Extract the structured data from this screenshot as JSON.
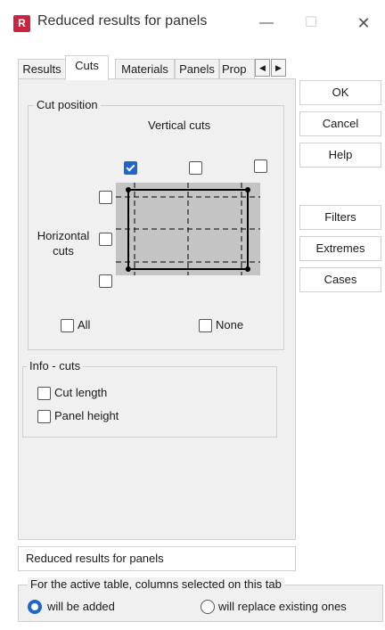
{
  "window": {
    "title": "Reduced results for panels",
    "icon_letter": "R"
  },
  "tabs": [
    "Results",
    "Cuts",
    "Materials",
    "Panels",
    "Prop"
  ],
  "active_tab": "Cuts",
  "cut_position": {
    "legend": "Cut position",
    "vertical_label": "Vertical cuts",
    "horizontal_label": "Horizontal cuts",
    "all_label": "All",
    "none_label": "None"
  },
  "info_cuts": {
    "legend": "Info - cuts",
    "cut_length": "Cut length",
    "panel_height": "Panel height"
  },
  "buttons": {
    "ok": "OK",
    "cancel": "Cancel",
    "help": "Help",
    "filters": "Filters",
    "extremes": "Extremes",
    "cases": "Cases"
  },
  "bottom": {
    "name_field": "Reduced results for panels",
    "group_legend": "For the active table, columns selected on this tab",
    "radio_added": "will be added",
    "radio_replace": "will replace existing ones"
  },
  "colors": {
    "accent": "#1f66c8",
    "icon": "#c9243f"
  }
}
